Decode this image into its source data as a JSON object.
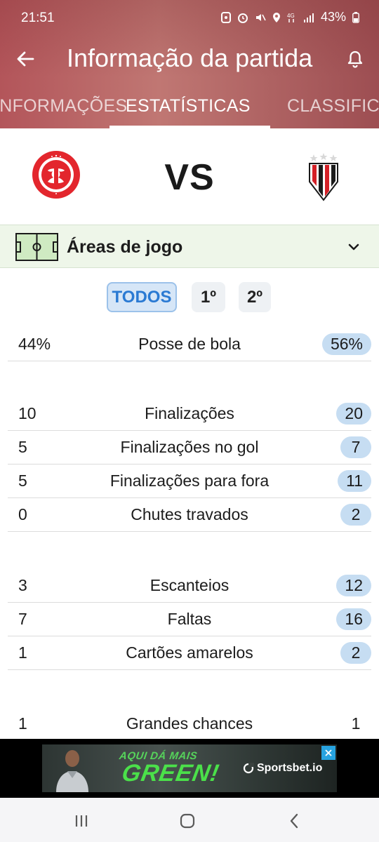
{
  "status_bar": {
    "time": "21:51",
    "battery": "43%"
  },
  "app_bar": {
    "title": "Informação da partida"
  },
  "tabs": [
    {
      "label": "INFORMAÇÕES",
      "active": false
    },
    {
      "label": "ESTATÍSTICAS",
      "active": true
    },
    {
      "label": "CLASSIFICAÇÃO",
      "active": false
    }
  ],
  "match": {
    "vs": "VS",
    "home_team_icon": "internacional-crest",
    "away_team_icon": "atletico-go-crest"
  },
  "areas": {
    "label": "Áreas de jogo",
    "icon": "soccer-field-icon"
  },
  "periods": [
    {
      "label": "TODOS",
      "selected": true
    },
    {
      "label": "1º",
      "selected": false
    },
    {
      "label": "2º",
      "selected": false
    }
  ],
  "stats": [
    {
      "label": "Posse de bola",
      "home": "44%",
      "away": "56%",
      "away_highlight": true
    },
    {
      "label": "Finalizações",
      "home": "10",
      "away": "20",
      "away_highlight": true
    },
    {
      "label": "Finalizações no gol",
      "home": "5",
      "away": "7",
      "away_highlight": true
    },
    {
      "label": "Finalizações para fora",
      "home": "5",
      "away": "11",
      "away_highlight": true
    },
    {
      "label": "Chutes travados",
      "home": "0",
      "away": "2",
      "away_highlight": true
    },
    {
      "label": "Escanteios",
      "home": "3",
      "away": "12",
      "away_highlight": true
    },
    {
      "label": "Faltas",
      "home": "7",
      "away": "16",
      "away_highlight": true
    },
    {
      "label": "Cartões amarelos",
      "home": "1",
      "away": "2",
      "away_highlight": true
    },
    {
      "label": "Grandes chances",
      "home": "1",
      "away": "1",
      "away_highlight": false
    }
  ],
  "ad": {
    "small_text": "AQUI DÁ MAIS",
    "big_text": "GREEN!",
    "brand": "Sportsbet.io"
  },
  "colors": {
    "header": "#b96762",
    "highlight_pill": "#c6ddf2",
    "selected_period": "#2a7ad3",
    "area_bg": "#eef6e9"
  }
}
